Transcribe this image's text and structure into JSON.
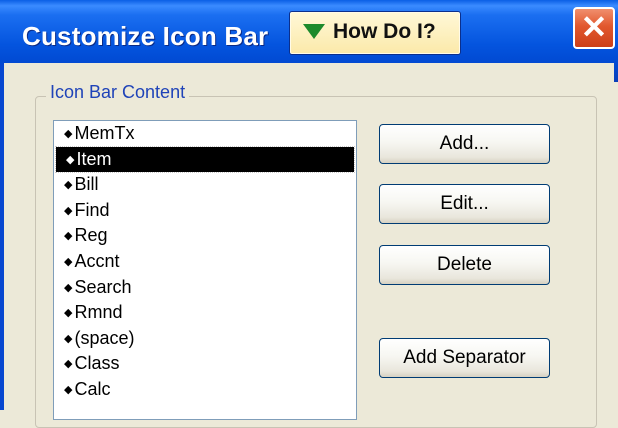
{
  "dialog": {
    "title": "Customize Icon Bar",
    "help_button": {
      "label": "How Do I?",
      "icon": "green-down-triangle-icon"
    },
    "close_icon": "close-icon"
  },
  "group": {
    "title": "Icon Bar Content"
  },
  "list": {
    "items": [
      "MemTx",
      "Item",
      "Bill",
      "Find",
      "Reg",
      "Accnt",
      "Search",
      "Rmnd",
      "(space)",
      "Class",
      "Calc"
    ],
    "selected": "Item"
  },
  "buttons": {
    "add": "Add...",
    "edit": "Edit...",
    "delete": "Delete",
    "add_separator": "Add Separator"
  },
  "colors": {
    "titlebar": "#0454de",
    "close_button": "#e2582e",
    "help_button_bg": "#fbe9a9",
    "selection": "#000000",
    "group_title_text": "#1f43b8"
  }
}
